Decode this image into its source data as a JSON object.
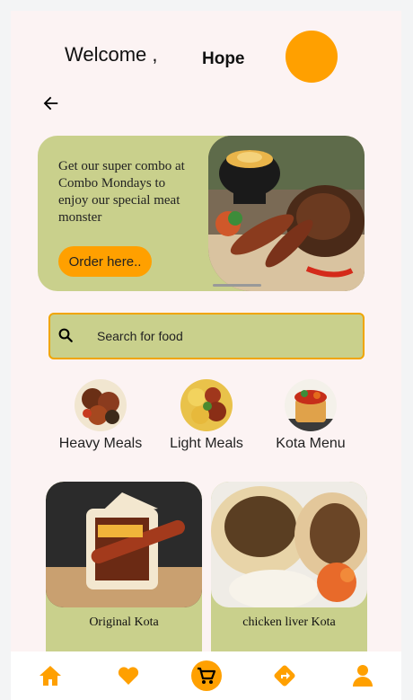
{
  "header": {
    "welcome_text": "Welcome ,",
    "username": "Hope"
  },
  "promo": {
    "text": "Get our super combo at Combo Mondays to enjoy our special meat monster",
    "button_label": "Order here.."
  },
  "search": {
    "placeholder": "Search for food"
  },
  "categories": [
    {
      "label": "Heavy Meals"
    },
    {
      "label": "Light Meals"
    },
    {
      "label": "Kota Menu"
    }
  ],
  "products": [
    {
      "title": "Original Kota"
    },
    {
      "title": "chicken liver Kota"
    }
  ],
  "bottom_nav": [
    "home-icon",
    "heart-icon",
    "cart-icon",
    "directions-icon",
    "profile-icon"
  ],
  "colors": {
    "accent": "#ffa000",
    "card_green": "#c9d08c",
    "background": "#fcf3f3"
  }
}
